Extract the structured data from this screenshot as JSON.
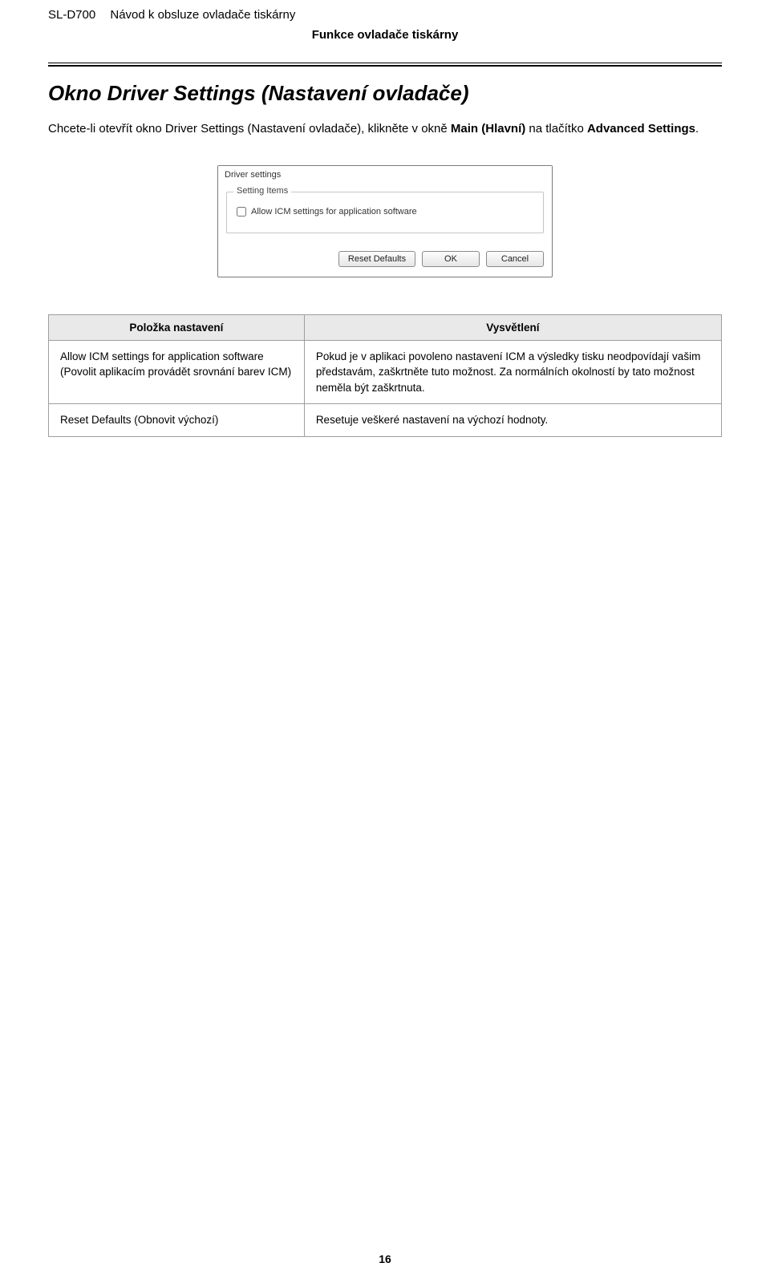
{
  "header": {
    "model": "SL-D700",
    "doc_title": "Návod k obsluze ovladače tiskárny",
    "section_label": "Funkce ovladače tiskárny"
  },
  "heading": "Okno Driver Settings (Nastavení ovladače)",
  "body_paragraph": {
    "pre": "Chcete-li otevřít okno Driver Settings (Nastavení ovladače), klikněte v okně ",
    "bold1": "Main (Hlavní)",
    "mid": " na tlačítko ",
    "bold2": "Advanced Settings",
    "post": "."
  },
  "dialog": {
    "title": "Driver settings",
    "group_title": "Setting Items",
    "checkbox_label": "Allow ICM settings for application software",
    "buttons": {
      "reset": "Reset Defaults",
      "ok": "OK",
      "cancel": "Cancel"
    }
  },
  "table": {
    "headers": {
      "left": "Položka nastavení",
      "right": "Vysvětlení"
    },
    "rows": [
      {
        "left": "Allow ICM settings for application software (Povolit aplikacím provádět srovnání barev ICM)",
        "right": "Pokud je v aplikaci povoleno nastavení ICM a výsledky tisku neodpovídají vašim představám, zaškrtněte tuto možnost. Za normálních okolností by tato možnost neměla být zaškrtnuta."
      },
      {
        "left": "Reset Defaults (Obnovit výchozí)",
        "right": "Resetuje veškeré nastavení na výchozí hodnoty."
      }
    ]
  },
  "page_number": "16"
}
